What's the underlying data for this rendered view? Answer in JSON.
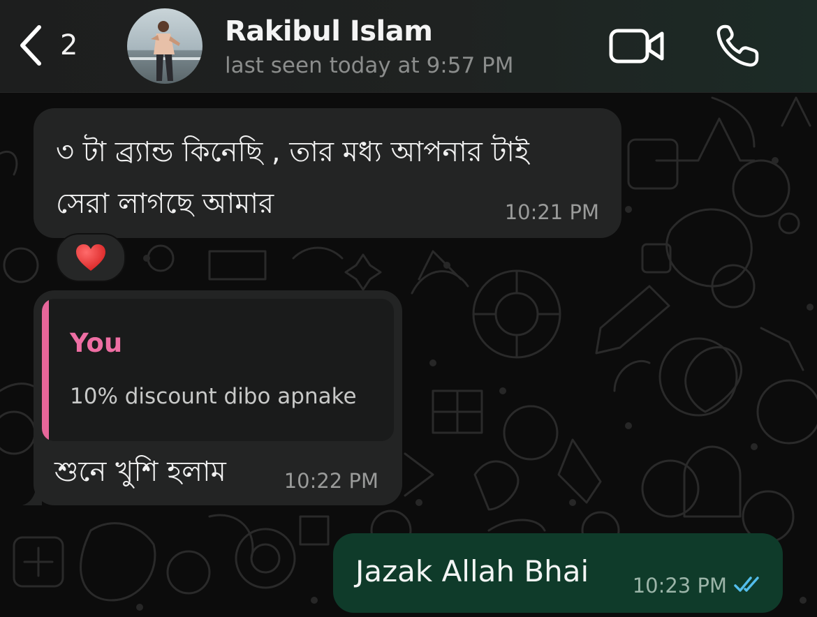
{
  "header": {
    "back_count": "2",
    "contact_name": "Rakibul Islam",
    "last_seen": "last seen today at 9:57 PM"
  },
  "messages": [
    {
      "direction": "incoming",
      "text_line1": "৩ টা ব্র্যান্ড কিনেছি , তার মধ্য আপনার টাই",
      "text_line2": "সেরা লাগছে আমার",
      "time": "10:21 PM",
      "reaction": "❤️"
    },
    {
      "direction": "incoming",
      "quote_author": "You",
      "quote_text": "10% discount dibo apnake",
      "text": "শুনে খুশি হলাম",
      "time": "10:22 PM"
    },
    {
      "direction": "outgoing",
      "text": "Jazak Allah Bhai",
      "time": "10:23 PM",
      "status": "read"
    }
  ],
  "colors": {
    "header_bg": "#1f2221",
    "incoming_bubble": "#232424",
    "outgoing_bubble": "#0f3b2a",
    "quote_accent": "#e7669a",
    "read_ticks": "#53bdeb"
  },
  "icons": {
    "back": "chevron-left-icon",
    "video": "video-camera-icon",
    "call": "phone-icon",
    "read": "double-check-icon"
  }
}
